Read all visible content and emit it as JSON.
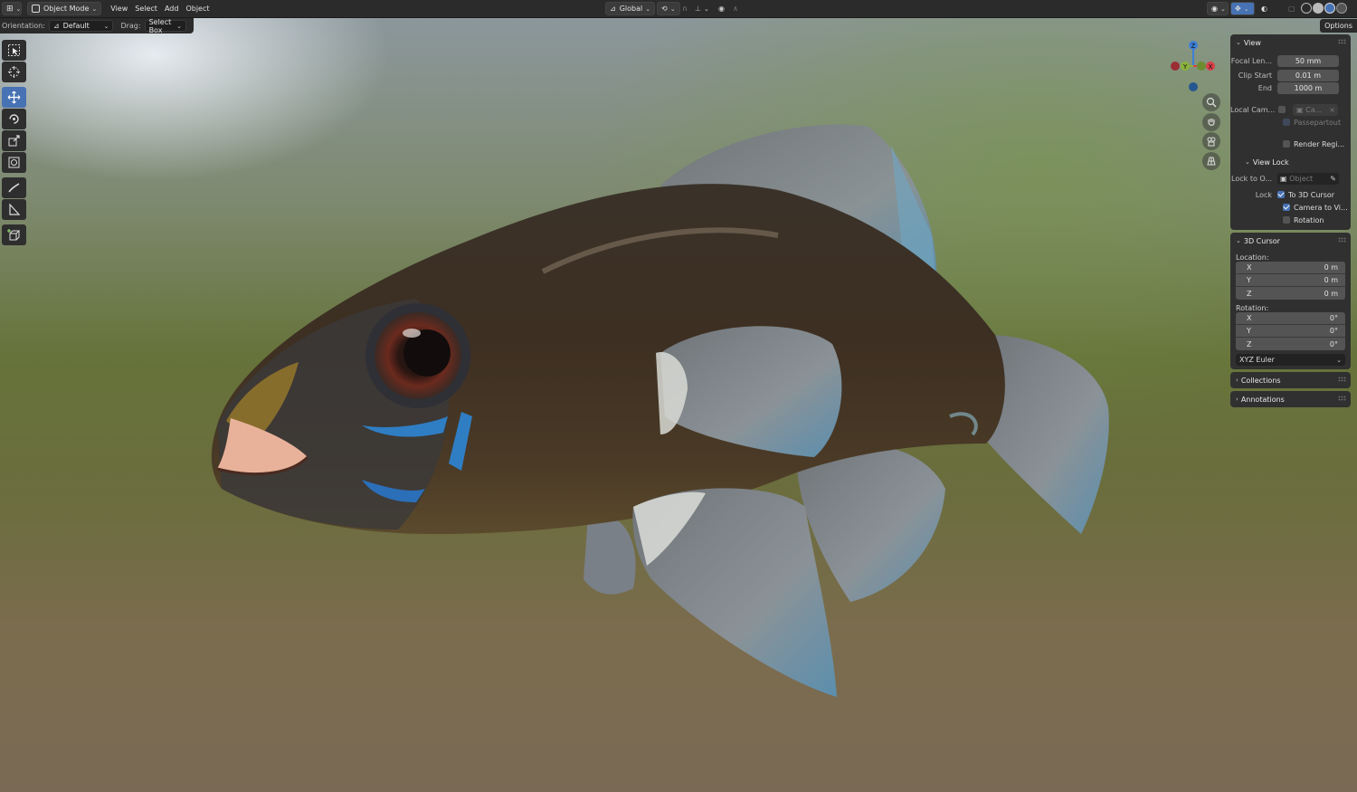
{
  "header": {
    "mode": "Object Mode",
    "menus": [
      "View",
      "Select",
      "Add",
      "Object"
    ],
    "transform_orientation": "Global"
  },
  "tool_settings": {
    "orientation_label": "Orientation:",
    "orientation_value": "Default",
    "drag_label": "Drag:",
    "drag_value": "Select Box",
    "options_label": "Options"
  },
  "sidebar": {
    "view": {
      "title": "View",
      "focal_label": "Focal Len...",
      "focal_value": "50 mm",
      "clip_start_label": "Clip Start",
      "clip_start_value": "0.01 m",
      "end_label": "End",
      "end_value": "1000 m",
      "local_cam_label": "Local Cam...",
      "local_cam_value": "Ca...",
      "passepartout": "Passepartout",
      "render_region": "Render Regi...",
      "view_lock": {
        "title": "View Lock",
        "lock_to_label": "Lock to O...",
        "lock_to_placeholder": "Object",
        "lock_label": "Lock",
        "to_3d_cursor": "To 3D Cursor",
        "camera_to_view": "Camera to Vi...",
        "rotation": "Rotation"
      }
    },
    "cursor": {
      "title": "3D Cursor",
      "location_label": "Location:",
      "location": [
        {
          "axis": "X",
          "value": "0 m"
        },
        {
          "axis": "Y",
          "value": "0 m"
        },
        {
          "axis": "Z",
          "value": "0 m"
        }
      ],
      "rotation_label": "Rotation:",
      "rotation": [
        {
          "axis": "X",
          "value": "0°"
        },
        {
          "axis": "Y",
          "value": "0°"
        },
        {
          "axis": "Z",
          "value": "0°"
        }
      ],
      "rotation_mode": "XYZ Euler"
    },
    "collections": "Collections",
    "annotations": "Annotations"
  },
  "gizmo": {
    "z": "Z",
    "y": "Y",
    "x": "X"
  },
  "colors": {
    "accent": "#4772b3",
    "header": "#2b2b2b",
    "panel": "#303030",
    "field": "#545454"
  }
}
